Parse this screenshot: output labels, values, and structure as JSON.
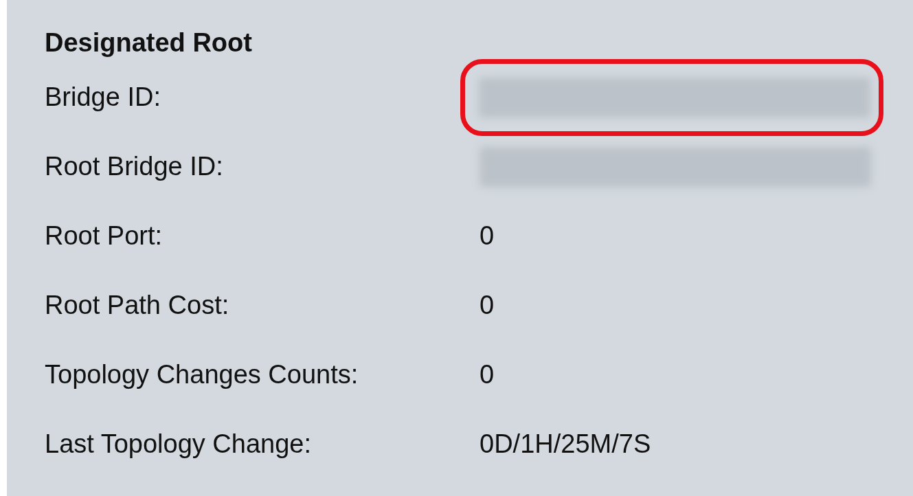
{
  "section": {
    "title": "Designated Root"
  },
  "rows": [
    {
      "label": "Bridge ID:",
      "kind": "redacted",
      "highlighted": true
    },
    {
      "label": "Root Bridge ID:",
      "kind": "redacted",
      "highlighted": false
    },
    {
      "label": "Root Port:",
      "kind": "text",
      "value": "0",
      "highlighted": false
    },
    {
      "label": "Root Path Cost:",
      "kind": "text",
      "value": "0",
      "highlighted": false
    },
    {
      "label": "Topology Changes Counts:",
      "kind": "text",
      "value": "0",
      "highlighted": false
    },
    {
      "label": "Last Topology Change:",
      "kind": "text",
      "value": "0D/1H/25M/7S",
      "highlighted": false
    }
  ]
}
